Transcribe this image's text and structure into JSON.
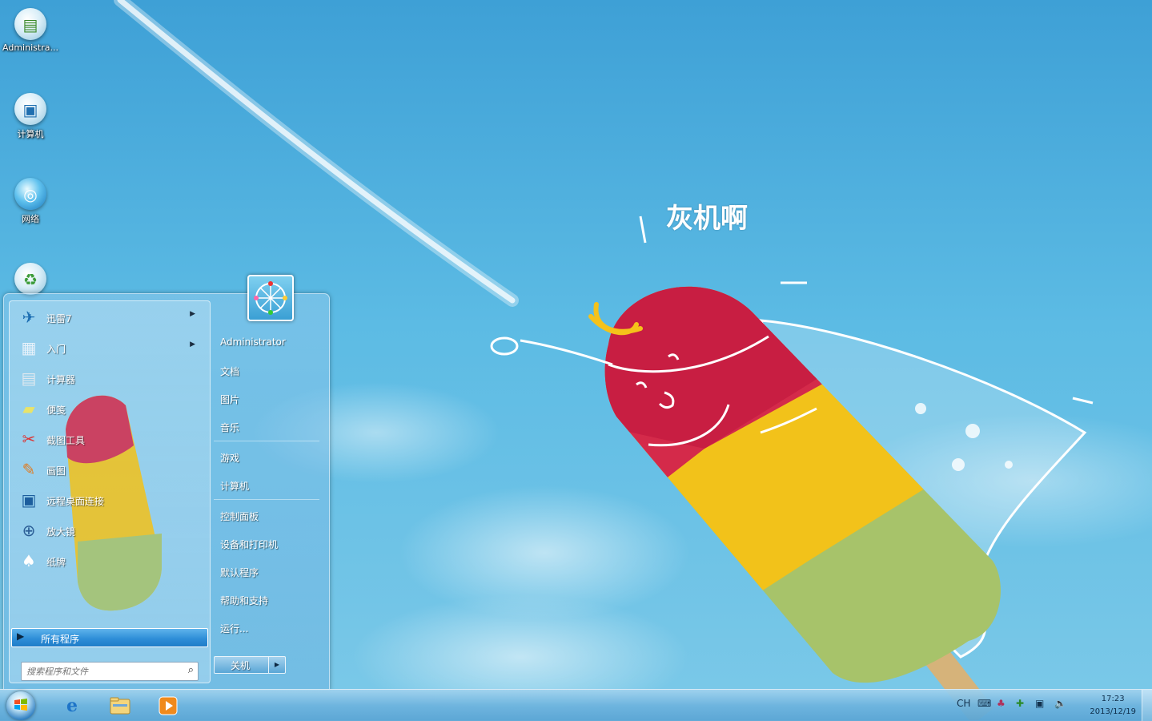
{
  "desktop": {
    "wallpaper_text": "灰机啊",
    "icons": [
      {
        "label": "Administra...",
        "icon": "user-folder-icon"
      },
      {
        "label": "计算机",
        "icon": "computer-icon"
      },
      {
        "label": "网络",
        "icon": "network-icon"
      },
      {
        "label": "",
        "icon": "recycle-bin-icon"
      }
    ]
  },
  "start_menu": {
    "programs": [
      {
        "label": "迅雷7",
        "icon": "thunder-bird-icon",
        "has_submenu": true
      },
      {
        "label": "入门",
        "icon": "getting-started-icon",
        "has_submenu": true
      },
      {
        "label": "计算器",
        "icon": "calculator-icon",
        "has_submenu": false
      },
      {
        "label": "便笺",
        "icon": "sticky-notes-icon",
        "has_submenu": false
      },
      {
        "label": "截图工具",
        "icon": "snipping-tool-icon",
        "has_submenu": false
      },
      {
        "label": "画图",
        "icon": "paint-icon",
        "has_submenu": false
      },
      {
        "label": "远程桌面连接",
        "icon": "remote-desktop-icon",
        "has_submenu": false
      },
      {
        "label": "放大镜",
        "icon": "magnifier-icon",
        "has_submenu": false
      },
      {
        "label": "纸牌",
        "icon": "solitaire-icon",
        "has_submenu": false
      }
    ],
    "all_programs": "所有程序",
    "search_placeholder": "搜索程序和文件",
    "places": [
      {
        "label": "Administrator"
      },
      {
        "label": "文档"
      },
      {
        "label": "图片"
      },
      {
        "label": "音乐"
      },
      {
        "label": "游戏"
      },
      {
        "label": "计算机"
      },
      {
        "label": "控制面板"
      },
      {
        "label": "设备和打印机"
      },
      {
        "label": "默认程序"
      },
      {
        "label": "帮助和支持"
      },
      {
        "label": "运行..."
      }
    ],
    "shutdown_label": "关机"
  },
  "taskbar": {
    "pinned": [
      {
        "name": "internet-explorer",
        "icon": "ie-icon"
      },
      {
        "name": "windows-explorer",
        "icon": "folder-icon"
      },
      {
        "name": "media-player",
        "icon": "media-player-icon"
      }
    ],
    "tray": {
      "language": "CH",
      "time": "17:23",
      "date": "2013/12/19"
    }
  }
}
